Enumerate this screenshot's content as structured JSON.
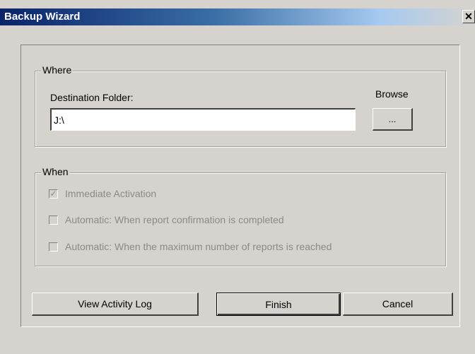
{
  "window": {
    "title": "Backup Wizard",
    "close_glyph": "✕"
  },
  "where": {
    "legend": "Where",
    "destination_label": "Destination Folder:",
    "destination_value": "J:\\",
    "browse_label": "Browse",
    "browse_button": "..."
  },
  "when": {
    "legend": "When",
    "options": [
      {
        "label": "Immediate Activation",
        "checked": true,
        "enabled": false
      },
      {
        "label": "Automatic: When report confirmation is completed",
        "checked": false,
        "enabled": false
      },
      {
        "label": "Automatic: When the maximum number of reports is reached",
        "checked": false,
        "enabled": false
      }
    ]
  },
  "buttons": {
    "view_log": "View Activity Log",
    "finish": "Finish",
    "cancel": "Cancel"
  },
  "colors": {
    "titlebar_start": "#0a246a",
    "face": "#d6d3ce",
    "disabled_text": "#8c8a86"
  }
}
